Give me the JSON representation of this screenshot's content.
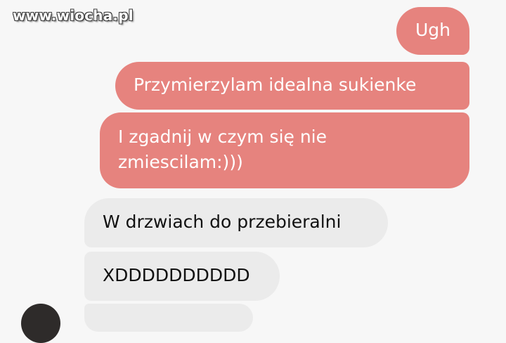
{
  "watermark": {
    "text": "www.wiocha.pl"
  },
  "conversation": {
    "messages": [
      {
        "sender": "me",
        "text": "Ugh"
      },
      {
        "sender": "me",
        "text": "Przymierzylam idealna sukienke"
      },
      {
        "sender": "me",
        "text": "I zgadnij w czym się nie\nzmiescilam:)))"
      },
      {
        "sender": "other",
        "text": "W drzwiach do przebieralni"
      },
      {
        "sender": "other",
        "text": "XDDDDDDDDDD"
      }
    ]
  },
  "colors": {
    "sent_bubble": "#e6837e",
    "received_bubble": "#ebebeb",
    "background": "#f7f7f7"
  }
}
